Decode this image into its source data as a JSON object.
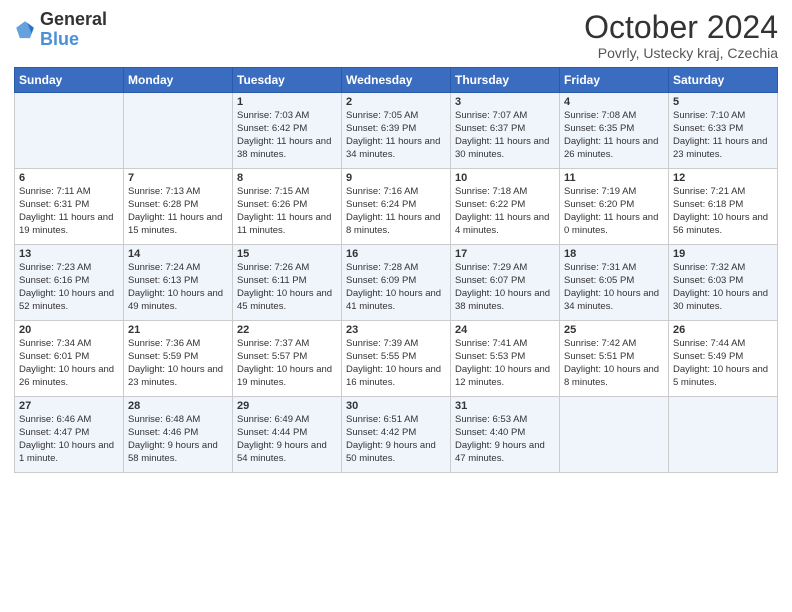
{
  "logo": {
    "general": "General",
    "blue": "Blue"
  },
  "header": {
    "month": "October 2024",
    "location": "Povrly, Ustecky kraj, Czechia"
  },
  "weekdays": [
    "Sunday",
    "Monday",
    "Tuesday",
    "Wednesday",
    "Thursday",
    "Friday",
    "Saturday"
  ],
  "weeks": [
    [
      {
        "day": "",
        "info": ""
      },
      {
        "day": "",
        "info": ""
      },
      {
        "day": "1",
        "info": "Sunrise: 7:03 AM\nSunset: 6:42 PM\nDaylight: 11 hours and 38 minutes."
      },
      {
        "day": "2",
        "info": "Sunrise: 7:05 AM\nSunset: 6:39 PM\nDaylight: 11 hours and 34 minutes."
      },
      {
        "day": "3",
        "info": "Sunrise: 7:07 AM\nSunset: 6:37 PM\nDaylight: 11 hours and 30 minutes."
      },
      {
        "day": "4",
        "info": "Sunrise: 7:08 AM\nSunset: 6:35 PM\nDaylight: 11 hours and 26 minutes."
      },
      {
        "day": "5",
        "info": "Sunrise: 7:10 AM\nSunset: 6:33 PM\nDaylight: 11 hours and 23 minutes."
      }
    ],
    [
      {
        "day": "6",
        "info": "Sunrise: 7:11 AM\nSunset: 6:31 PM\nDaylight: 11 hours and 19 minutes."
      },
      {
        "day": "7",
        "info": "Sunrise: 7:13 AM\nSunset: 6:28 PM\nDaylight: 11 hours and 15 minutes."
      },
      {
        "day": "8",
        "info": "Sunrise: 7:15 AM\nSunset: 6:26 PM\nDaylight: 11 hours and 11 minutes."
      },
      {
        "day": "9",
        "info": "Sunrise: 7:16 AM\nSunset: 6:24 PM\nDaylight: 11 hours and 8 minutes."
      },
      {
        "day": "10",
        "info": "Sunrise: 7:18 AM\nSunset: 6:22 PM\nDaylight: 11 hours and 4 minutes."
      },
      {
        "day": "11",
        "info": "Sunrise: 7:19 AM\nSunset: 6:20 PM\nDaylight: 11 hours and 0 minutes."
      },
      {
        "day": "12",
        "info": "Sunrise: 7:21 AM\nSunset: 6:18 PM\nDaylight: 10 hours and 56 minutes."
      }
    ],
    [
      {
        "day": "13",
        "info": "Sunrise: 7:23 AM\nSunset: 6:16 PM\nDaylight: 10 hours and 52 minutes."
      },
      {
        "day": "14",
        "info": "Sunrise: 7:24 AM\nSunset: 6:13 PM\nDaylight: 10 hours and 49 minutes."
      },
      {
        "day": "15",
        "info": "Sunrise: 7:26 AM\nSunset: 6:11 PM\nDaylight: 10 hours and 45 minutes."
      },
      {
        "day": "16",
        "info": "Sunrise: 7:28 AM\nSunset: 6:09 PM\nDaylight: 10 hours and 41 minutes."
      },
      {
        "day": "17",
        "info": "Sunrise: 7:29 AM\nSunset: 6:07 PM\nDaylight: 10 hours and 38 minutes."
      },
      {
        "day": "18",
        "info": "Sunrise: 7:31 AM\nSunset: 6:05 PM\nDaylight: 10 hours and 34 minutes."
      },
      {
        "day": "19",
        "info": "Sunrise: 7:32 AM\nSunset: 6:03 PM\nDaylight: 10 hours and 30 minutes."
      }
    ],
    [
      {
        "day": "20",
        "info": "Sunrise: 7:34 AM\nSunset: 6:01 PM\nDaylight: 10 hours and 26 minutes."
      },
      {
        "day": "21",
        "info": "Sunrise: 7:36 AM\nSunset: 5:59 PM\nDaylight: 10 hours and 23 minutes."
      },
      {
        "day": "22",
        "info": "Sunrise: 7:37 AM\nSunset: 5:57 PM\nDaylight: 10 hours and 19 minutes."
      },
      {
        "day": "23",
        "info": "Sunrise: 7:39 AM\nSunset: 5:55 PM\nDaylight: 10 hours and 16 minutes."
      },
      {
        "day": "24",
        "info": "Sunrise: 7:41 AM\nSunset: 5:53 PM\nDaylight: 10 hours and 12 minutes."
      },
      {
        "day": "25",
        "info": "Sunrise: 7:42 AM\nSunset: 5:51 PM\nDaylight: 10 hours and 8 minutes."
      },
      {
        "day": "26",
        "info": "Sunrise: 7:44 AM\nSunset: 5:49 PM\nDaylight: 10 hours and 5 minutes."
      }
    ],
    [
      {
        "day": "27",
        "info": "Sunrise: 6:46 AM\nSunset: 4:47 PM\nDaylight: 10 hours and 1 minute."
      },
      {
        "day": "28",
        "info": "Sunrise: 6:48 AM\nSunset: 4:46 PM\nDaylight: 9 hours and 58 minutes."
      },
      {
        "day": "29",
        "info": "Sunrise: 6:49 AM\nSunset: 4:44 PM\nDaylight: 9 hours and 54 minutes."
      },
      {
        "day": "30",
        "info": "Sunrise: 6:51 AM\nSunset: 4:42 PM\nDaylight: 9 hours and 50 minutes."
      },
      {
        "day": "31",
        "info": "Sunrise: 6:53 AM\nSunset: 4:40 PM\nDaylight: 9 hours and 47 minutes."
      },
      {
        "day": "",
        "info": ""
      },
      {
        "day": "",
        "info": ""
      }
    ]
  ]
}
